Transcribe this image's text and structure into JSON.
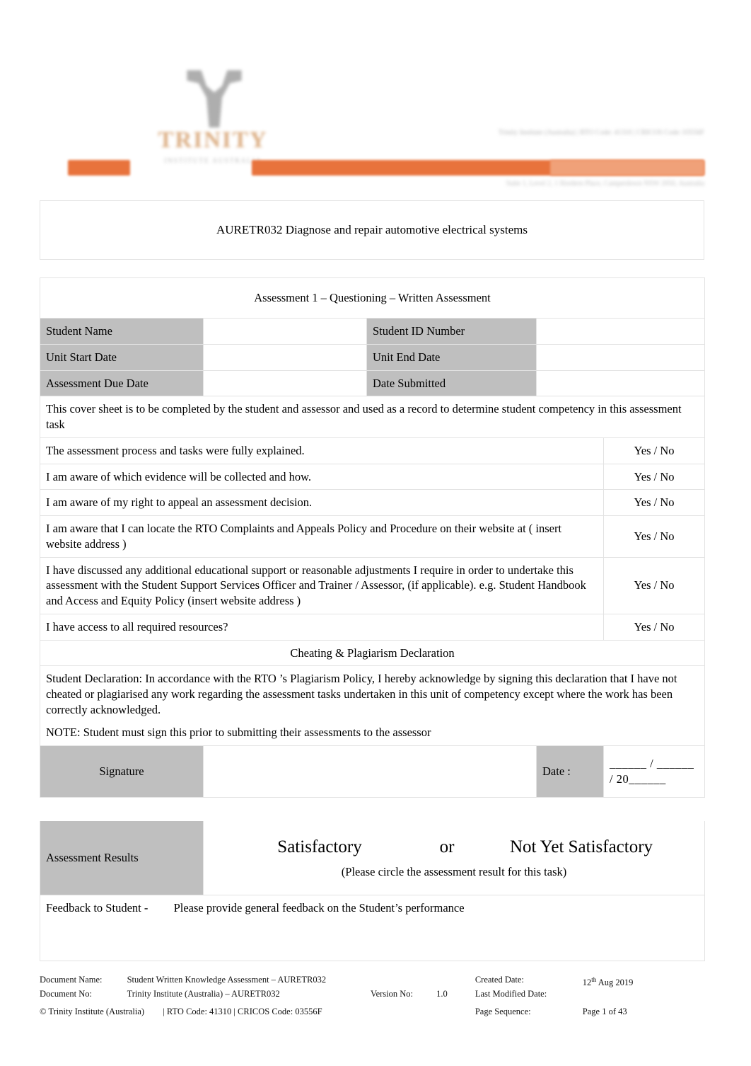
{
  "header": {
    "logo_word": "TRINITY",
    "logo_sub": "INSTITUTE AUSTRALIA",
    "blurred_line_1": "Trinity Institute (Australia) | RTO Code: 41310 | CRICOS Code: 03556F",
    "blurred_line_2": "Suite 1, Level 2, 1 Hordern Place, Camperdown NSW 2050, Australia"
  },
  "unit_title": "AURETR032 Diagnose and repair automotive electrical systems",
  "assessment_title": "Assessment 1 – Questioning – Written Assessment",
  "student_info": {
    "rows": [
      {
        "left_label": "Student Name",
        "left_value": "",
        "right_label": "Student ID Number",
        "right_value": ""
      },
      {
        "left_label": "Unit Start Date",
        "left_value": "",
        "right_label": "Unit End Date",
        "right_value": ""
      },
      {
        "left_label": "Assessment Due Date",
        "left_value": "",
        "right_label": "Date Submitted",
        "right_value": ""
      }
    ]
  },
  "cover_note": "This cover sheet is to be completed by the student and assessor and used as a record to determine student competency in this assessment task",
  "checklist": {
    "answer_label": "Yes / No",
    "items": [
      "The assessment process and tasks were fully explained.",
      "I am aware of which evidence will be collected and how.",
      "I am aware of my right to appeal an assessment decision.",
      "I am aware that I can locate      the RTO   Complaints and Appeals Policy and Procedure         on their website at (  insert website address     )",
      "I have discussed any additional educational support or reasonable adjustments I require in order to undertake this assessment with the Student Support Services Officer and Trainer / Assessor, (if applicable). e.g.    Student Handbook    and  Access and Equity Policy    (insert website address     )",
      "I have access to all required resources?"
    ]
  },
  "declaration": {
    "heading": "Cheating & Plagiarism Declaration",
    "body": "Student Declaration:       In accordance with    the RTO  ’s Plagiarism Policy, I hereby acknowledge by signing this declaration that I have not cheated or plagiarised any work regarding the assessment tasks undertaken in this unit of competency except where the work has been correctly acknowledged.",
    "note": "NOTE: Student must sign this prior to submitting their assessments to the assessor"
  },
  "signature": {
    "label": "Signature",
    "value": "",
    "date_label": "Date :",
    "date_slots": "______ / ______ / 20______"
  },
  "results": {
    "label": "Assessment Results",
    "satisfactory": "Satisfactory",
    "or": "or",
    "not_yet_satisfactory": "Not Yet  Satisfactory",
    "note": "(Please circle the assessment result for this task)"
  },
  "feedback": {
    "label": "Feedback to Student -",
    "prompt": "Please provide general feedback on the Student’s performance",
    "value": ""
  },
  "footer": {
    "doc_name_label": "Document Name:",
    "doc_name_value": "Student Written Knowledge Assessment – AURETR032",
    "doc_no_label": "Document No:",
    "doc_no_value": "Trinity Institute (Australia)   – AURETR032",
    "version_label": "Version No:",
    "version_value": "1.0",
    "created_label": "Created Date:",
    "created_value": "12",
    "created_sup": "th",
    "created_rest": " Aug 2019",
    "last_modified_label": "Last Modified Date:",
    "last_modified_value": "",
    "page_sequence_label": "Page Sequence:",
    "page_sequence_value": "Page   1 of 43",
    "copyright": "© Trinity Institute (Australia)",
    "codes": "| RTO Code: 41310 | CRICOS Code: 03556F"
  },
  "colors": {
    "accent_orange": "#e8733c",
    "accent_orange_light": "#f0a179",
    "cell_gray": "#bfbfbf",
    "border_gray": "#e3e3e3"
  }
}
